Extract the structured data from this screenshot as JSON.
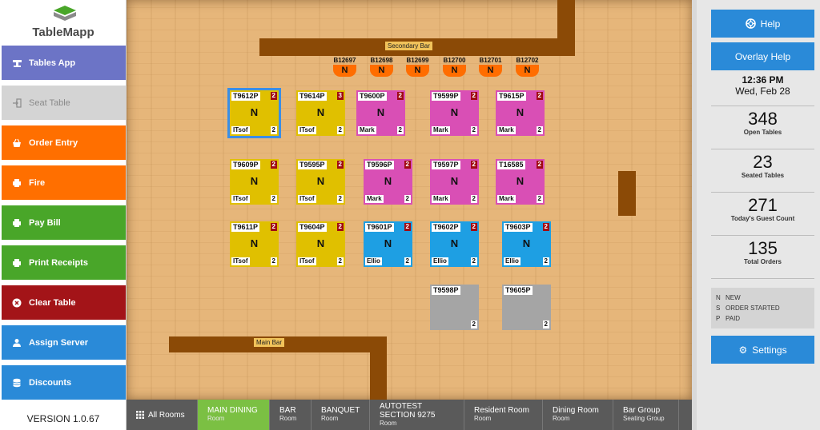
{
  "app": {
    "brand": "TableMapp",
    "version": "VERSION 1.0.67"
  },
  "colors": {
    "new_status": "#e0c000",
    "order_started": "#d94fb5",
    "paid": "#1e9fe3",
    "empty": "#a5a5a5",
    "bar_stool": "#ff6d00",
    "wall": "#8b4a06",
    "help_button": "#2a8ad8"
  },
  "sidebar": [
    {
      "label": "Tables App",
      "icon": "tables-app-icon",
      "color": "#6c74c6"
    },
    {
      "label": "Seat Table",
      "icon": "seat-icon",
      "color": "#d4d4d4"
    },
    {
      "label": "Order Entry",
      "icon": "basket-icon",
      "color": "#ff6f00"
    },
    {
      "label": "Fire",
      "icon": "printer-icon",
      "color": "#ff6f00"
    },
    {
      "label": "Pay Bill",
      "icon": "printer-icon",
      "color": "#49a629"
    },
    {
      "label": "Print Receipts",
      "icon": "printer-icon",
      "color": "#49a629"
    },
    {
      "label": "Clear Table",
      "icon": "close-circle-icon",
      "color": "#a31418"
    },
    {
      "label": "Assign Server",
      "icon": "user-icon",
      "color": "#2a8ad8"
    },
    {
      "label": "Discounts",
      "icon": "database-icon",
      "color": "#2a8ad8"
    }
  ],
  "floor": {
    "secondary_bar_label": "Secondary Bar",
    "main_bar_label": "Main Bar",
    "bar_stools": [
      {
        "id": "B12697",
        "status": "N"
      },
      {
        "id": "B12698",
        "status": "N"
      },
      {
        "id": "B12699",
        "status": "N"
      },
      {
        "id": "B12700",
        "status": "N"
      },
      {
        "id": "B12701",
        "status": "N"
      },
      {
        "id": "B12702",
        "status": "N"
      }
    ],
    "tables": [
      {
        "id": "T9612P",
        "status": "N",
        "server": "ITsof",
        "seats": "2",
        "count": "2",
        "color": "#e0c000",
        "selected": true
      },
      {
        "id": "T9614P",
        "status": "N",
        "server": "ITsof",
        "seats": "2",
        "count": "3",
        "color": "#e0c000"
      },
      {
        "id": "T9600P",
        "status": "N",
        "server": "Mark",
        "seats": "2",
        "count": "2",
        "color": "#d94fb5"
      },
      {
        "id": "T9599P",
        "status": "N",
        "server": "Mark",
        "seats": "2",
        "count": "2",
        "color": "#d94fb5"
      },
      {
        "id": "T9615P",
        "status": "N",
        "server": "Mark",
        "seats": "2",
        "count": "2",
        "color": "#d94fb5"
      },
      {
        "id": "T9609P",
        "status": "N",
        "server": "ITsof",
        "seats": "2",
        "count": "2",
        "color": "#e0c000"
      },
      {
        "id": "T9595P",
        "status": "N",
        "server": "ITsof",
        "seats": "2",
        "count": "2",
        "color": "#e0c000"
      },
      {
        "id": "T9596P",
        "status": "N",
        "server": "Mark",
        "seats": "2",
        "count": "2",
        "color": "#d94fb5"
      },
      {
        "id": "T9597P",
        "status": "N",
        "server": "Mark",
        "seats": "2",
        "count": "2",
        "color": "#d94fb5"
      },
      {
        "id": "T16585",
        "status": "N",
        "server": "Mark",
        "seats": "2",
        "count": "2",
        "color": "#d94fb5"
      },
      {
        "id": "T9611P",
        "status": "N",
        "server": "ITsof",
        "seats": "2",
        "count": "2",
        "color": "#e0c000"
      },
      {
        "id": "T9604P",
        "status": "N",
        "server": "ITsof",
        "seats": "2",
        "count": "2",
        "color": "#e0c000"
      },
      {
        "id": "T9601P",
        "status": "N",
        "server": "Ellio",
        "seats": "2",
        "count": "2",
        "color": "#1e9fe3"
      },
      {
        "id": "T9602P",
        "status": "N",
        "server": "Ellio",
        "seats": "2",
        "count": "2",
        "color": "#1e9fe3"
      },
      {
        "id": "T9603P",
        "status": "N",
        "server": "Ellio",
        "seats": "2",
        "count": "2",
        "color": "#1e9fe3"
      },
      {
        "id": "T9598P",
        "status": "",
        "server": "",
        "seats": "2",
        "count": "",
        "color": "#a5a5a5"
      },
      {
        "id": "T9605P",
        "status": "",
        "server": "",
        "seats": "2",
        "count": "",
        "color": "#a5a5a5"
      }
    ]
  },
  "rooms": [
    {
      "name": "All Rooms",
      "sub": "",
      "active": false
    },
    {
      "name": "MAIN DINING",
      "sub": "Room",
      "active": true
    },
    {
      "name": "BAR",
      "sub": "Room",
      "active": false
    },
    {
      "name": "BANQUET",
      "sub": "Room",
      "active": false
    },
    {
      "name": "AUTOTEST SECTION 9275",
      "sub": "Room",
      "active": false
    },
    {
      "name": "Resident Room",
      "sub": "Room",
      "active": false
    },
    {
      "name": "Dining Room",
      "sub": "Room",
      "active": false
    },
    {
      "name": "Bar Group",
      "sub": "Seating Group",
      "active": false
    }
  ],
  "right_panel": {
    "help": "Help",
    "overlay_help": "Overlay Help",
    "time": "12:36 PM",
    "date": "Wed, Feb 28",
    "stats": [
      {
        "value": "348",
        "label": "Open Tables"
      },
      {
        "value": "23",
        "label": "Seated Tables"
      },
      {
        "value": "271",
        "label": "Today's Guest Count"
      },
      {
        "value": "135",
        "label": "Total Orders"
      }
    ],
    "legend": [
      {
        "key": "N",
        "label": "NEW"
      },
      {
        "key": "S",
        "label": "ORDER STARTED"
      },
      {
        "key": "P",
        "label": "PAID"
      }
    ],
    "settings": "Settings"
  }
}
